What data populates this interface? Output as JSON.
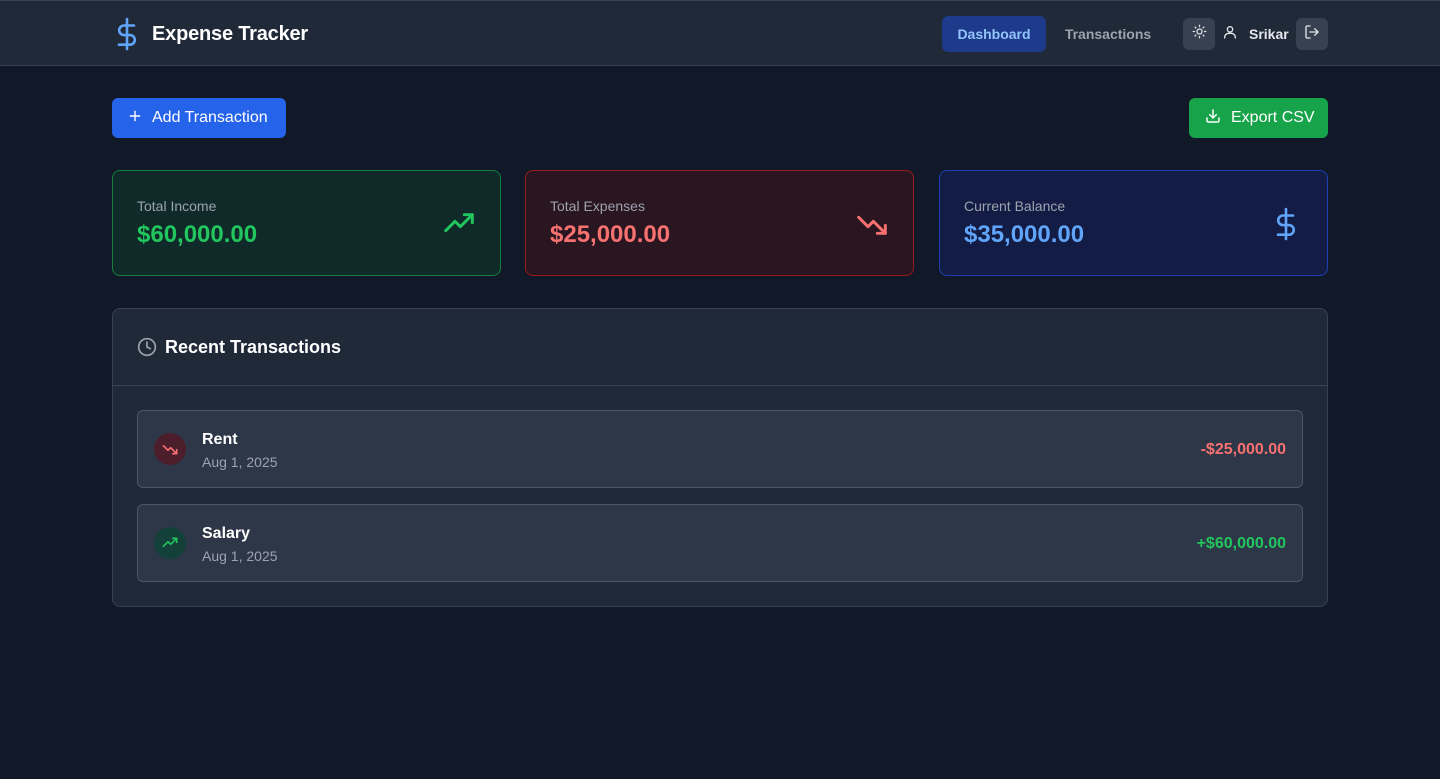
{
  "header": {
    "app_title": "Expense Tracker",
    "logo_icon": "dollar-sign-icon",
    "nav": [
      {
        "label": "Dashboard",
        "active": true
      },
      {
        "label": "Transactions",
        "active": false
      }
    ],
    "theme_icon": "sun-icon",
    "user_icon": "user-icon",
    "username": "Srikar",
    "logout_icon": "logout-icon"
  },
  "actions": {
    "add_label": "Add Transaction",
    "add_icon": "plus-icon",
    "export_label": "Export CSV",
    "export_icon": "download-icon"
  },
  "summary": [
    {
      "label": "Total Income",
      "value": "$60,000.00",
      "icon": "trending-up-icon",
      "color": "#22c55e"
    },
    {
      "label": "Total Expenses",
      "value": "$25,000.00",
      "icon": "trending-down-icon",
      "color": "#f87171"
    },
    {
      "label": "Current Balance",
      "value": "$35,000.00",
      "icon": "dollar-sign-icon",
      "color": "#60a5fa"
    }
  ],
  "recent": {
    "title": "Recent Transactions",
    "icon": "clock-icon",
    "items": [
      {
        "name": "Rent",
        "date": "Aug 1, 2025",
        "amount": "-$25,000.00",
        "type": "expense",
        "icon": "trending-down-icon"
      },
      {
        "name": "Salary",
        "date": "Aug 1, 2025",
        "amount": "+$60,000.00",
        "type": "income",
        "icon": "trending-up-icon"
      }
    ]
  },
  "colors": {
    "background": "#111827",
    "header": "#1f2937",
    "primary": "#2563eb",
    "success": "#16a34a",
    "income": "#22c55e",
    "expense": "#f87171",
    "balance": "#60a5fa"
  }
}
